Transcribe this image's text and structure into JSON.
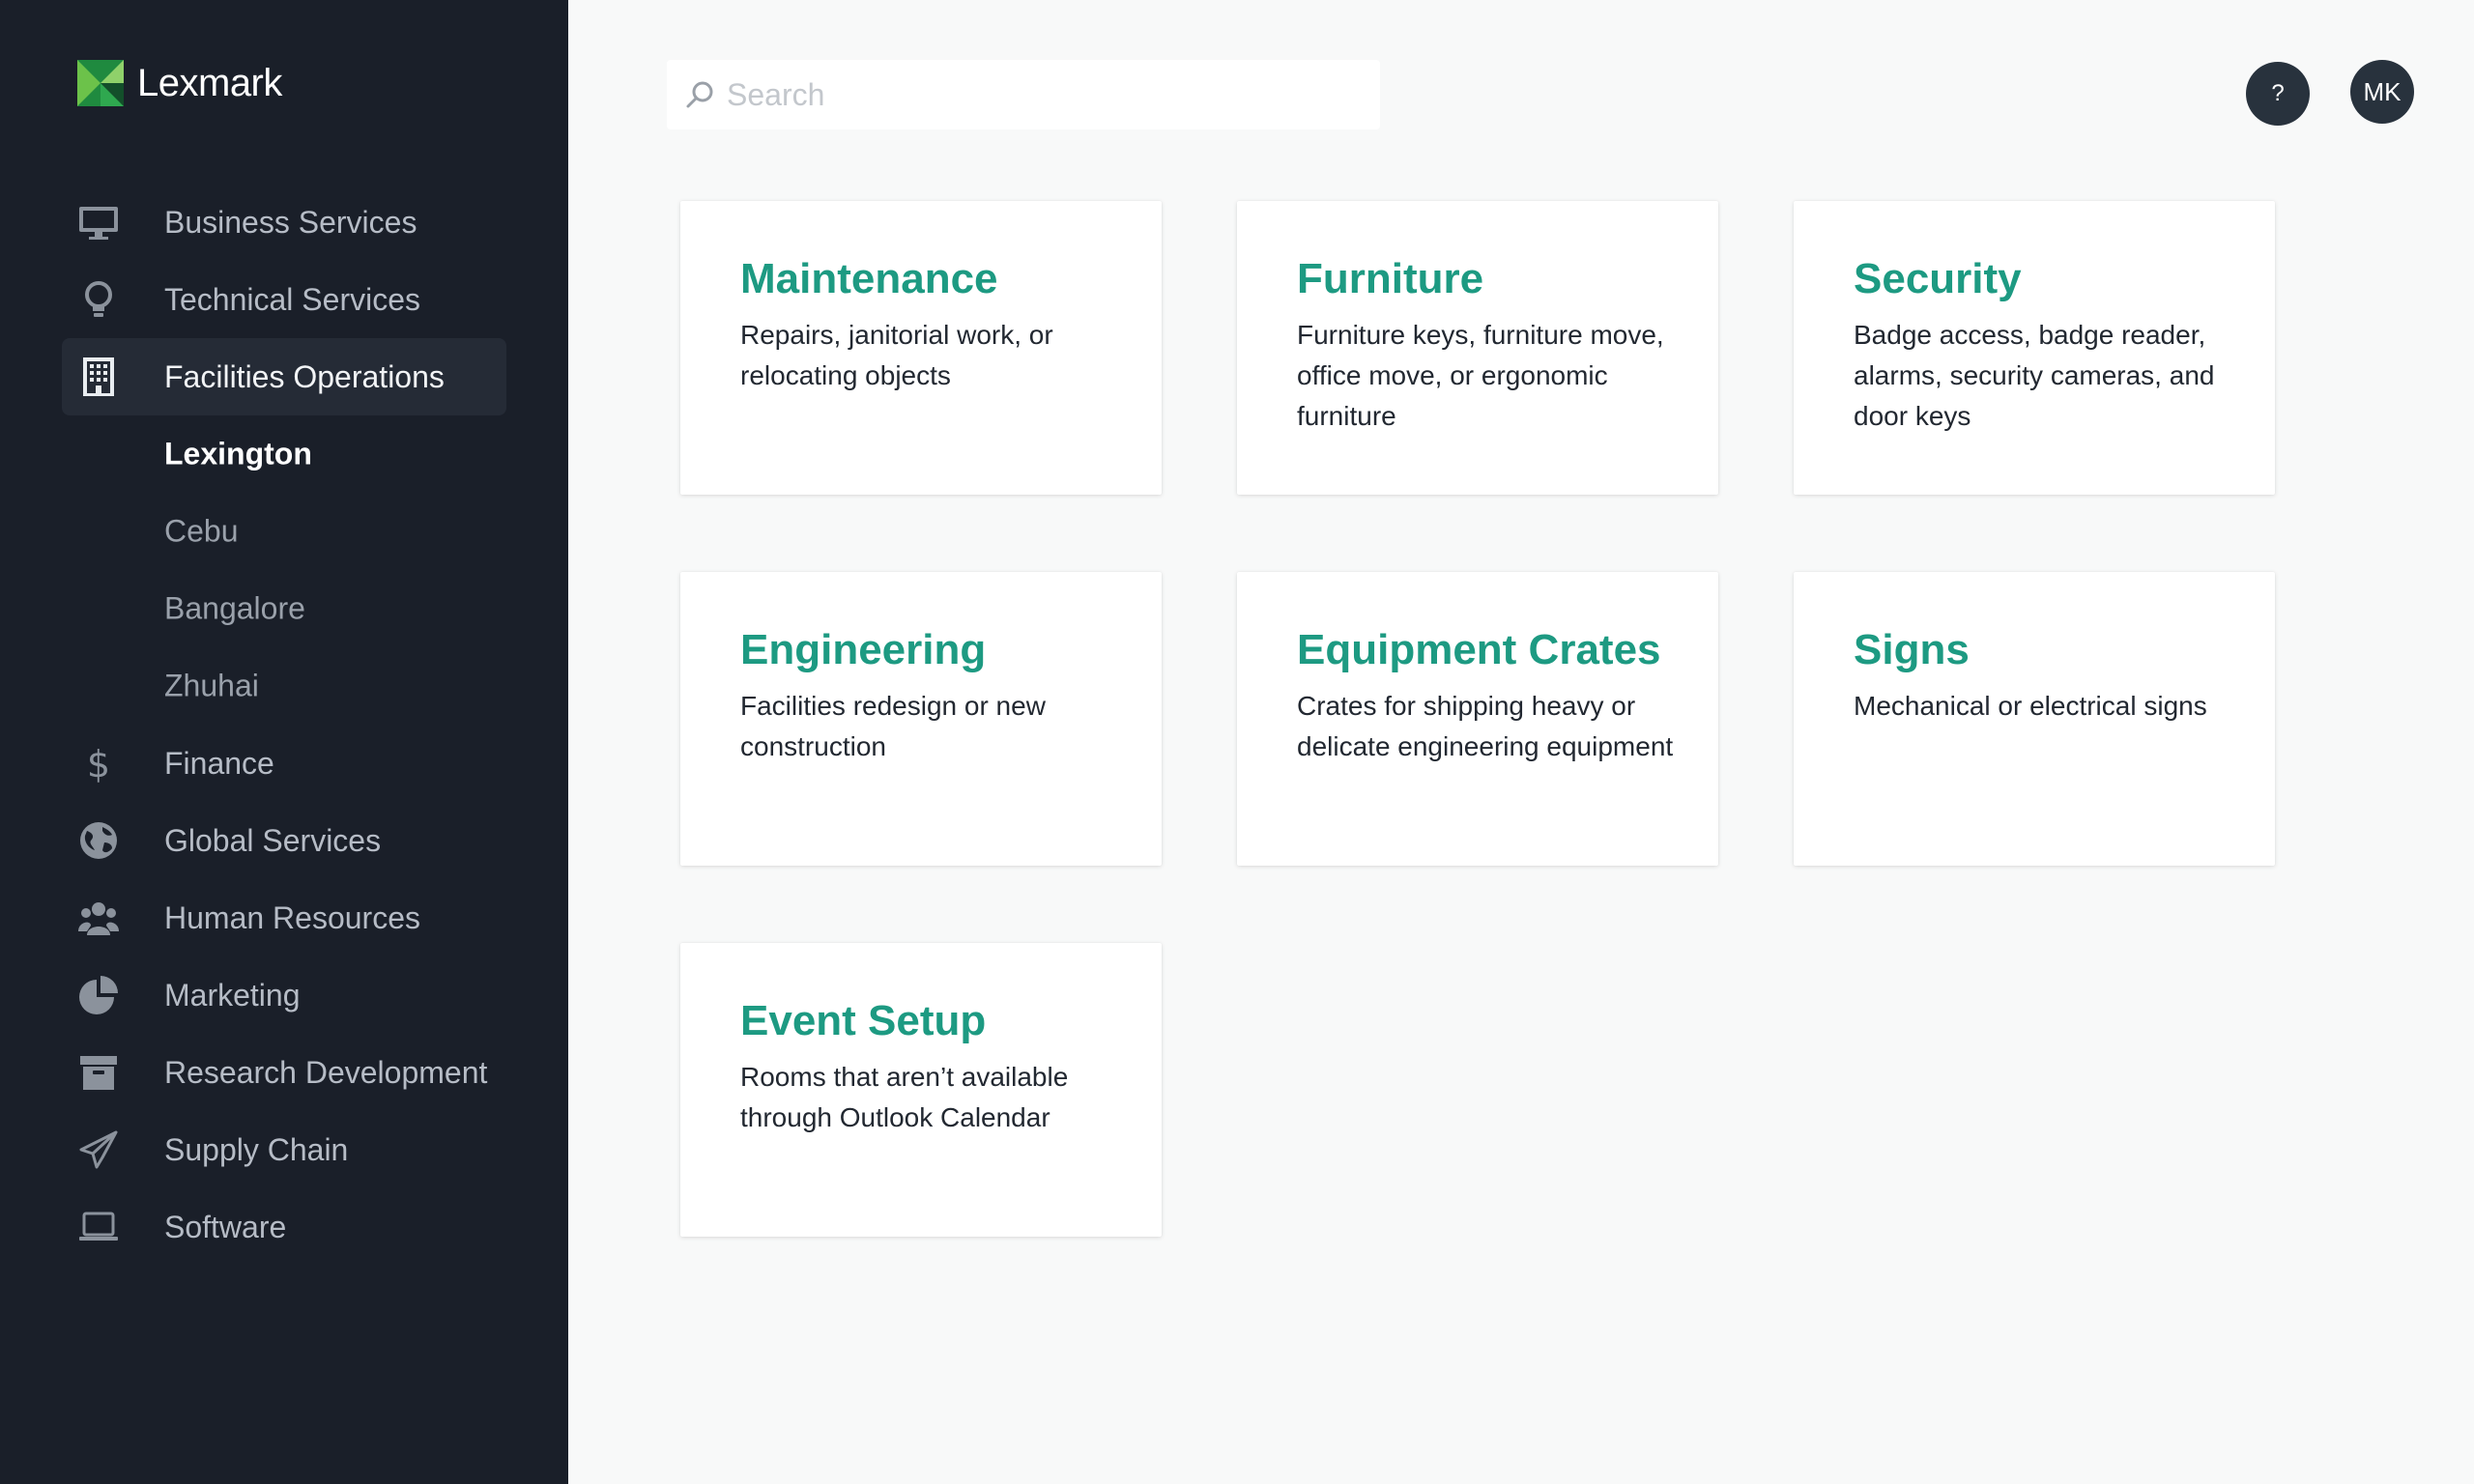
{
  "brand": {
    "name": "Lexmark",
    "colors": {
      "green_light": "#6cc24a",
      "green_dark": "#1f8a3f",
      "accent": "#1d9a82"
    }
  },
  "sidebar": {
    "items": [
      {
        "label": "Business Services",
        "icon": "monitor-icon"
      },
      {
        "label": "Technical Services",
        "icon": "lightbulb-icon"
      },
      {
        "label": "Facilities Operations",
        "icon": "building-icon",
        "active": true
      },
      {
        "label": "Finance",
        "icon": "dollar-icon"
      },
      {
        "label": "Global Services",
        "icon": "globe-icon"
      },
      {
        "label": "Human Resources",
        "icon": "people-icon"
      },
      {
        "label": "Marketing",
        "icon": "pie-chart-icon"
      },
      {
        "label": "Research Development",
        "icon": "archive-box-icon"
      },
      {
        "label": "Supply Chain",
        "icon": "paper-plane-icon"
      },
      {
        "label": "Software",
        "icon": "laptop-icon"
      }
    ],
    "subitems": [
      {
        "label": "Lexington",
        "active": true
      },
      {
        "label": "Cebu"
      },
      {
        "label": "Bangalore"
      },
      {
        "label": "Zhuhai"
      }
    ]
  },
  "header": {
    "search_placeholder": "Search",
    "help_label": "?",
    "avatar_initials": "MK"
  },
  "cards": [
    {
      "title": "Maintenance",
      "description": "Repairs, janitorial work, or relocating objects"
    },
    {
      "title": "Furniture",
      "description": "Furniture keys, furniture move, office move, or ergonomic furniture"
    },
    {
      "title": "Security",
      "description": "Badge access, badge reader, alarms, security cameras, and door keys"
    },
    {
      "title": "Engineering",
      "description": "Facilities redesign or new construction"
    },
    {
      "title": "Equipment Crates",
      "description": "Crates for shipping heavy or delicate engineering equipment"
    },
    {
      "title": "Signs",
      "description": "Mechanical or electrical signs"
    },
    {
      "title": "Event Setup",
      "description": "Rooms that aren’t available through Outlook Calendar"
    }
  ]
}
